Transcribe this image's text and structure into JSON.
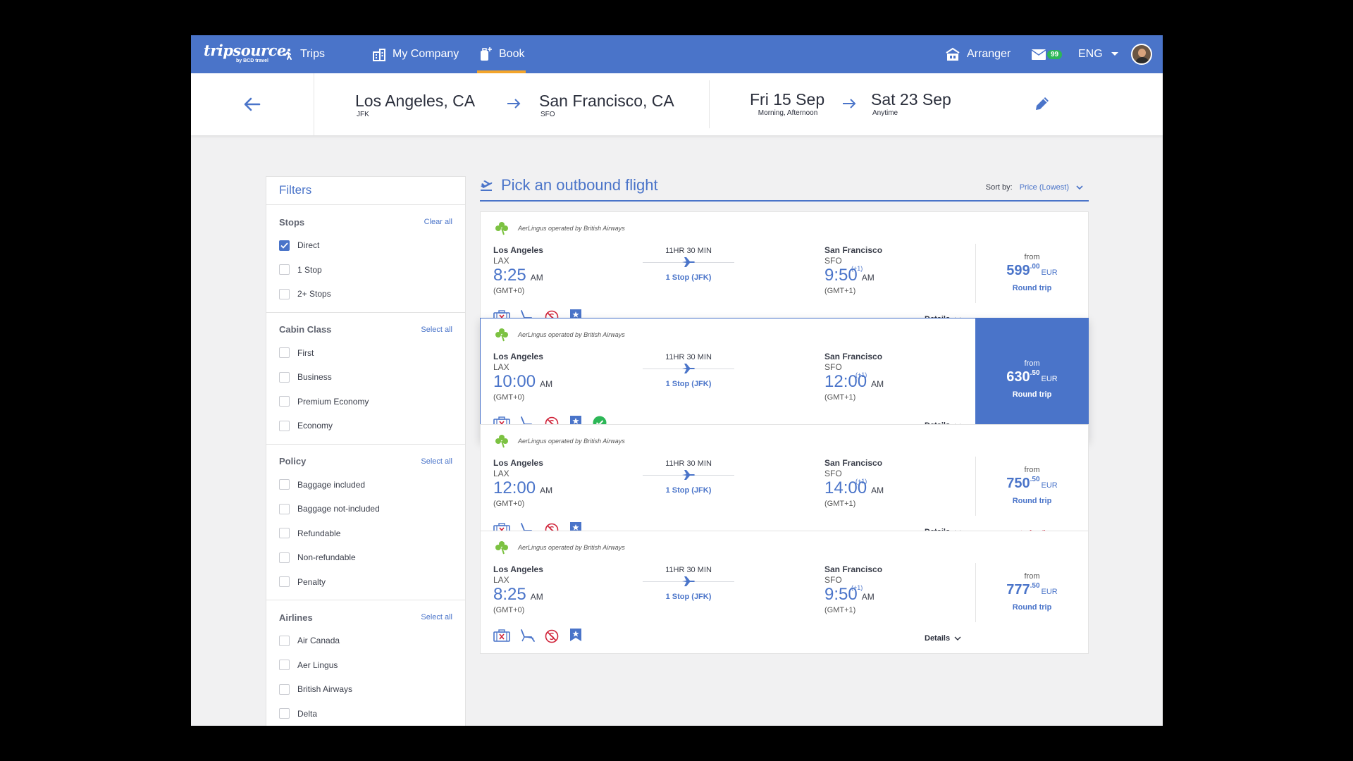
{
  "nav": {
    "logo": "tripsource",
    "logo_sub": "by BCD travel",
    "items": [
      {
        "label": "Trips",
        "icon": "traveler-icon"
      },
      {
        "label": "My Company",
        "icon": "building-icon"
      },
      {
        "label": "Book",
        "icon": "luggage-add-icon",
        "active": true
      }
    ],
    "arranger": "Arranger",
    "mail_count": "99",
    "language": "ENG"
  },
  "search": {
    "origin": "Los Angeles, CA",
    "origin_code": "JFK",
    "destination": "San Francisco, CA",
    "destination_code": "SFO",
    "depart_date": "Fri 15 Sep",
    "depart_time": "Morning, Afternoon",
    "return_date": "Sat 23 Sep",
    "return_time": "Anytime"
  },
  "filters": {
    "title": "Filters",
    "groups": [
      {
        "title": "Stops",
        "action": "Clear all",
        "options": [
          {
            "label": "Direct",
            "checked": true
          },
          {
            "label": "1 Stop",
            "checked": false
          },
          {
            "label": "2+ Stops",
            "checked": false
          }
        ]
      },
      {
        "title": "Cabin Class",
        "action": "Select all",
        "options": [
          {
            "label": "First",
            "checked": false
          },
          {
            "label": "Business",
            "checked": false
          },
          {
            "label": "Premium Economy",
            "checked": false
          },
          {
            "label": "Economy",
            "checked": false
          }
        ]
      },
      {
        "title": "Policy",
        "action": "Select all",
        "options": [
          {
            "label": "Baggage included",
            "checked": false
          },
          {
            "label": "Baggage not-included",
            "checked": false
          },
          {
            "label": "Refundable",
            "checked": false
          },
          {
            "label": "Non-refundable",
            "checked": false
          },
          {
            "label": "Penalty",
            "checked": false
          }
        ]
      },
      {
        "title": "Airlines",
        "action": "Select all",
        "options": [
          {
            "label": "Air Canada",
            "checked": false
          },
          {
            "label": "Aer Lingus",
            "checked": false
          },
          {
            "label": "British Airways",
            "checked": false
          },
          {
            "label": "Delta",
            "checked": false
          }
        ]
      }
    ]
  },
  "results": {
    "title": "Pick an outbound flight",
    "sort_label": "Sort by:",
    "sort_value": "Price  (Lowest)",
    "flights": [
      {
        "airline": "AerLingus operated by British Airways",
        "from_city": "Los Angeles",
        "from_code": "LAX",
        "dep_time": "8:25",
        "dep_ampm": "AM",
        "dep_gmt": "(GMT+0)",
        "duration": "11HR 30 MIN",
        "stops": "1 Stop (JFK)",
        "to_city": "San Francisco",
        "to_code": "SFO",
        "arr_time": "9:50",
        "arr_ampm": "AM",
        "arr_plus": "(+1)",
        "arr_gmt": "(GMT+1)",
        "details": "Details",
        "from_label": "from",
        "price_main": "599",
        "price_cents": ".00",
        "currency": "EUR",
        "trip_type": "Round trip",
        "in_policy": false,
        "policy_note": "",
        "selected": false
      },
      {
        "airline": "AerLingus operated by British Airways",
        "from_city": "Los Angeles",
        "from_code": "LAX",
        "dep_time": "10:00",
        "dep_ampm": "AM",
        "dep_gmt": "(GMT+0)",
        "duration": "11HR 30 MIN",
        "stops": "1 Stop (JFK)",
        "to_city": "San Francisco",
        "to_code": "SFO",
        "arr_time": "12:00",
        "arr_ampm": "AM",
        "arr_plus": "(+1)",
        "arr_gmt": "(GMT+1)",
        "details": "Details",
        "from_label": "from",
        "price_main": "630",
        "price_cents": ".50",
        "currency": "EUR",
        "trip_type": "Round trip",
        "in_policy": true,
        "policy_note": "",
        "selected": true
      },
      {
        "airline": "AerLingus operated by British Airways",
        "from_city": "Los Angeles",
        "from_code": "LAX",
        "dep_time": "12:00",
        "dep_ampm": "AM",
        "dep_gmt": "(GMT+0)",
        "duration": "11HR 30 MIN",
        "stops": "1 Stop (JFK)",
        "to_city": "San Francisco",
        "to_code": "SFO",
        "arr_time": "14:00",
        "arr_ampm": "AM",
        "arr_plus": "(+1)",
        "arr_gmt": "(GMT+1)",
        "details": "Details",
        "from_label": "from",
        "price_main": "750",
        "price_cents": ".50",
        "currency": "EUR",
        "trip_type": "Round trip",
        "in_policy": false,
        "policy_note": "out of policy",
        "selected": false
      },
      {
        "airline": "AerLingus operated by British Airways",
        "from_city": "Los Angeles",
        "from_code": "LAX",
        "dep_time": "8:25",
        "dep_ampm": "AM",
        "dep_gmt": "(GMT+0)",
        "duration": "11HR 30 MIN",
        "stops": "1 Stop (JFK)",
        "to_city": "San Francisco",
        "to_code": "SFO",
        "arr_time": "9:50",
        "arr_ampm": "AM",
        "arr_plus": "(+1)",
        "arr_gmt": "(GMT+1)",
        "details": "Details",
        "from_label": "from",
        "price_main": "777",
        "price_cents": ".50",
        "currency": "EUR",
        "trip_type": "Round trip",
        "in_policy": false,
        "policy_note": "",
        "selected": false
      }
    ]
  },
  "colors": {
    "brand": "#4a74c9",
    "accent": "#f4a52a",
    "success": "#2db757",
    "danger": "#d0243a",
    "shamrock": "#7cc242"
  }
}
